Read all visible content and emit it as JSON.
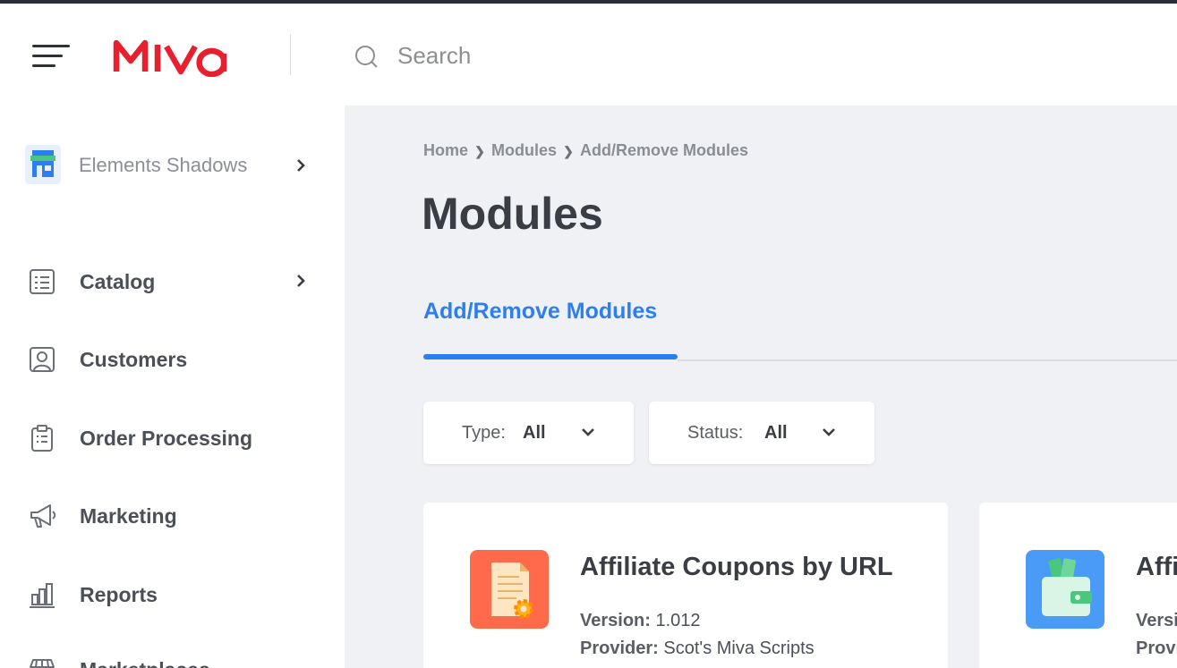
{
  "app": {
    "brand": "MIVA",
    "brand_color": "#e8202e",
    "accent_color": "#2d7ef0"
  },
  "search": {
    "placeholder": "Search",
    "value": ""
  },
  "sidebar": {
    "store_name": "Elements Shadows",
    "items": [
      {
        "label": "Catalog",
        "icon": "catalog-icon",
        "has_submenu": true
      },
      {
        "label": "Customers",
        "icon": "customers-icon"
      },
      {
        "label": "Order Processing",
        "icon": "clipboard-icon"
      },
      {
        "label": "Marketing",
        "icon": "megaphone-icon"
      },
      {
        "label": "Reports",
        "icon": "bar-chart-icon"
      },
      {
        "label": "Marketplaces",
        "icon": "store-icon"
      }
    ]
  },
  "breadcrumb": [
    "Home",
    "Modules",
    "Add/Remove Modules"
  ],
  "page_title": "Modules",
  "tabs": [
    {
      "label": "Add/Remove Modules",
      "active": true
    }
  ],
  "filters": [
    {
      "label": "Type:",
      "value": "All"
    },
    {
      "label": "Status:",
      "value": "All"
    }
  ],
  "modules": [
    {
      "title": "Affiliate Coupons by URL",
      "version_label": "Version:",
      "version": "1.012",
      "provider_label": "Provider:",
      "provider": "Scot's Miva Scripts",
      "icon": "document-gear-icon",
      "icon_color": "#ff6b4a"
    },
    {
      "title": "Affiliate",
      "version_label": "Version:",
      "version": "",
      "provider_label": "Provider:",
      "provider": "",
      "icon": "wallet-icon",
      "icon_color": "#4a9bf5"
    }
  ]
}
